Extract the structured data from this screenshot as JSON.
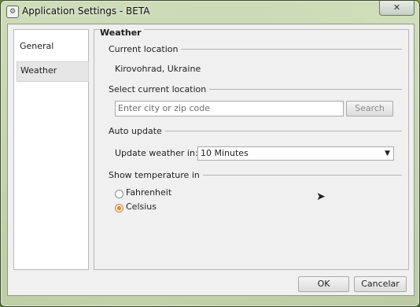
{
  "window": {
    "title": "Application Settings - BETA",
    "close_glyph": "✕"
  },
  "sidebar": {
    "items": [
      {
        "label": "General"
      },
      {
        "label": "Weather"
      }
    ]
  },
  "panel": {
    "title": "Weather",
    "current_location": {
      "header": "Current location",
      "value": "Kirovohrad, Ukraine"
    },
    "select_location": {
      "header": "Select current location",
      "placeholder": "Enter city or zip code",
      "search_label": "Search"
    },
    "auto_update": {
      "header": "Auto update",
      "label": "Update weather in:",
      "selected": "10 Minutes"
    },
    "temperature": {
      "header": "Show temperature in",
      "options": [
        {
          "label": "Fahrenheit",
          "checked": false
        },
        {
          "label": "Celsius",
          "checked": true
        }
      ]
    }
  },
  "footer": {
    "ok_label": "OK",
    "cancel_label": "Cancelar"
  },
  "colors": {
    "radio_accent": "#e08a2a"
  }
}
